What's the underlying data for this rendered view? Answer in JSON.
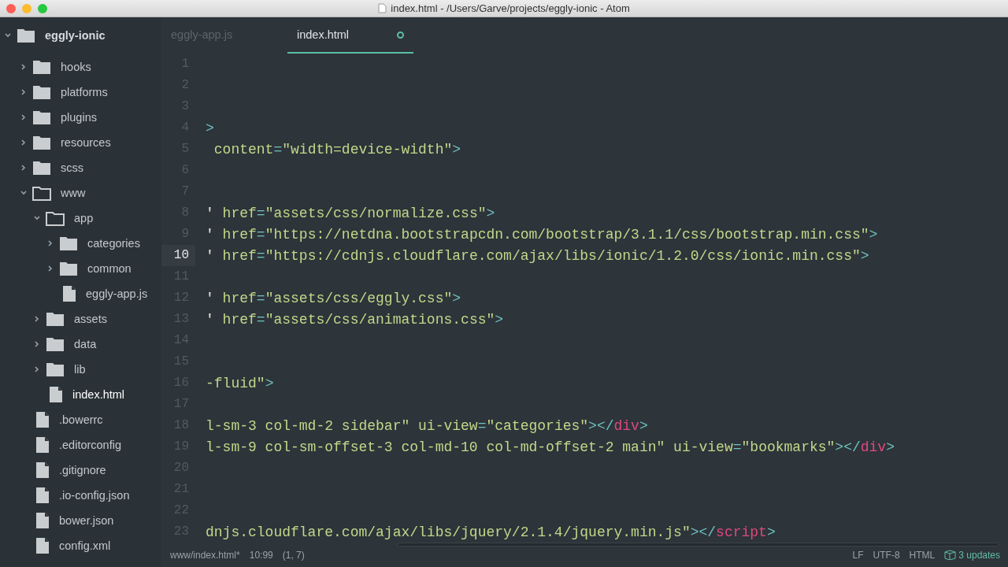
{
  "window": {
    "title": "index.html - /Users/Garve/projects/eggly-ionic - Atom"
  },
  "sidebar": {
    "root": {
      "label": "eggly-ionic",
      "expanded": true
    },
    "items": [
      {
        "kind": "folder",
        "label": "hooks",
        "expanded": false,
        "selected": false
      },
      {
        "kind": "folder",
        "label": "platforms",
        "expanded": false,
        "selected": false
      },
      {
        "kind": "folder",
        "label": "plugins",
        "expanded": false,
        "selected": false
      },
      {
        "kind": "folder",
        "label": "resources",
        "expanded": false,
        "selected": false
      },
      {
        "kind": "folder",
        "label": "scss",
        "expanded": false,
        "selected": false
      },
      {
        "kind": "folder",
        "label": "www",
        "expanded": true,
        "selected": false,
        "children": [
          {
            "kind": "folder",
            "label": "app",
            "expanded": true,
            "selected": false,
            "children": [
              {
                "kind": "folder",
                "label": "categories",
                "expanded": false,
                "selected": false
              },
              {
                "kind": "folder",
                "label": "common",
                "expanded": false,
                "selected": false
              },
              {
                "kind": "file",
                "label": "eggly-app.js",
                "selected": false
              }
            ]
          },
          {
            "kind": "folder",
            "label": "assets",
            "expanded": false,
            "selected": false
          },
          {
            "kind": "folder",
            "label": "data",
            "expanded": false,
            "selected": false
          },
          {
            "kind": "folder",
            "label": "lib",
            "expanded": false,
            "selected": false
          },
          {
            "kind": "file",
            "label": "index.html",
            "selected": true
          }
        ]
      },
      {
        "kind": "file",
        "label": ".bowerrc",
        "selected": false
      },
      {
        "kind": "file",
        "label": ".editorconfig",
        "selected": false
      },
      {
        "kind": "file",
        "label": ".gitignore",
        "selected": false
      },
      {
        "kind": "file",
        "label": ".io-config.json",
        "selected": false
      },
      {
        "kind": "file",
        "label": "bower.json",
        "selected": false
      },
      {
        "kind": "file",
        "label": "config.xml",
        "selected": false
      }
    ]
  },
  "tabs": [
    {
      "label": "eggly-app.js",
      "selected": false,
      "modified": false
    },
    {
      "label": "index.html",
      "selected": true,
      "modified": true
    }
  ],
  "editor": {
    "lines": [
      {
        "number": "1",
        "current": false
      },
      {
        "number": "2",
        "current": false
      },
      {
        "number": "3",
        "current": false
      },
      {
        "number": "4",
        "current": false,
        "tokens": [
          {
            "kind": "punct",
            "text": ">"
          }
        ]
      },
      {
        "number": "5",
        "current": false,
        "tokens": [
          {
            "kind": "text",
            "text": " content"
          },
          {
            "kind": "punct",
            "text": "="
          },
          {
            "kind": "text",
            "text": "\"width=device-width\""
          },
          {
            "kind": "punct",
            "text": ">"
          }
        ]
      },
      {
        "number": "6",
        "current": false
      },
      {
        "number": "7",
        "current": false
      },
      {
        "number": "8",
        "current": false,
        "tokens": [
          {
            "kind": "quote",
            "text": "'"
          },
          {
            "kind": "text",
            "text": " href"
          },
          {
            "kind": "punct",
            "text": "="
          },
          {
            "kind": "text",
            "text": "\"assets/css/normalize.css\""
          },
          {
            "kind": "punct",
            "text": ">"
          }
        ]
      },
      {
        "number": "9",
        "current": false,
        "tokens": [
          {
            "kind": "quote",
            "text": "'"
          },
          {
            "kind": "text",
            "text": " href"
          },
          {
            "kind": "punct",
            "text": "="
          },
          {
            "kind": "text",
            "text": "\"https://netdna.bootstrapcdn.com/bootstrap/3.1.1/css/bootstrap.min.css\""
          },
          {
            "kind": "punct",
            "text": ">"
          }
        ]
      },
      {
        "number": "10",
        "current": true,
        "tokens": [
          {
            "kind": "quote",
            "text": "'"
          },
          {
            "kind": "text",
            "text": " href"
          },
          {
            "kind": "punct",
            "text": "="
          },
          {
            "kind": "text",
            "text": "\"https://cdnjs.cloudflare.com/ajax/libs/ionic/1.2.0/css/ionic.min.css\""
          },
          {
            "kind": "punct",
            "text": ">"
          }
        ]
      },
      {
        "number": "11",
        "current": false
      },
      {
        "number": "12",
        "current": false,
        "tokens": [
          {
            "kind": "quote",
            "text": "'"
          },
          {
            "kind": "text",
            "text": " href"
          },
          {
            "kind": "punct",
            "text": "="
          },
          {
            "kind": "text",
            "text": "\"assets/css/eggly.css\""
          },
          {
            "kind": "punct",
            "text": ">"
          }
        ]
      },
      {
        "number": "13",
        "current": false,
        "tokens": [
          {
            "kind": "quote",
            "text": "'"
          },
          {
            "kind": "text",
            "text": " href"
          },
          {
            "kind": "punct",
            "text": "="
          },
          {
            "kind": "text",
            "text": "\"assets/css/animations.css\""
          },
          {
            "kind": "punct",
            "text": ">"
          }
        ]
      },
      {
        "number": "14",
        "current": false
      },
      {
        "number": "15",
        "current": false
      },
      {
        "number": "16",
        "current": false,
        "tokens": [
          {
            "kind": "text",
            "text": "-fluid\""
          },
          {
            "kind": "punct",
            "text": ">"
          }
        ]
      },
      {
        "number": "17",
        "current": false
      },
      {
        "number": "18",
        "current": false,
        "tokens": [
          {
            "kind": "text",
            "text": "l-sm-3 col-md-2 sidebar\" ui-view"
          },
          {
            "kind": "punct",
            "text": "="
          },
          {
            "kind": "text",
            "text": "\"categories\""
          },
          {
            "kind": "punct",
            "text": "></"
          },
          {
            "kind": "tag",
            "text": "div"
          },
          {
            "kind": "punct",
            "text": ">"
          }
        ]
      },
      {
        "number": "19",
        "current": false,
        "tokens": [
          {
            "kind": "text",
            "text": "l-sm-9 col-sm-offset-3 col-md-10 col-md-offset-2 main\" ui-view"
          },
          {
            "kind": "punct",
            "text": "="
          },
          {
            "kind": "text",
            "text": "\"bookmarks\""
          },
          {
            "kind": "punct",
            "text": "></"
          },
          {
            "kind": "tag",
            "text": "div"
          },
          {
            "kind": "punct",
            "text": ">"
          }
        ]
      },
      {
        "number": "20",
        "current": false
      },
      {
        "number": "21",
        "current": false
      },
      {
        "number": "22",
        "current": false
      },
      {
        "number": "23",
        "current": false,
        "tokens": [
          {
            "kind": "text",
            "text": "dnjs.cloudflare.com/ajax/libs/jquery/2.1.4/jquery.min.js\""
          },
          {
            "kind": "punct",
            "text": "></"
          },
          {
            "kind": "tag",
            "text": "script"
          },
          {
            "kind": "punct",
            "text": ">"
          }
        ]
      }
    ]
  },
  "status_bar": {
    "file": "www/index.html*",
    "position": "10:99",
    "selection": "(1, 7)",
    "line_ending": "LF",
    "encoding": "UTF-8",
    "grammar": "HTML",
    "updates": "3 updates"
  }
}
